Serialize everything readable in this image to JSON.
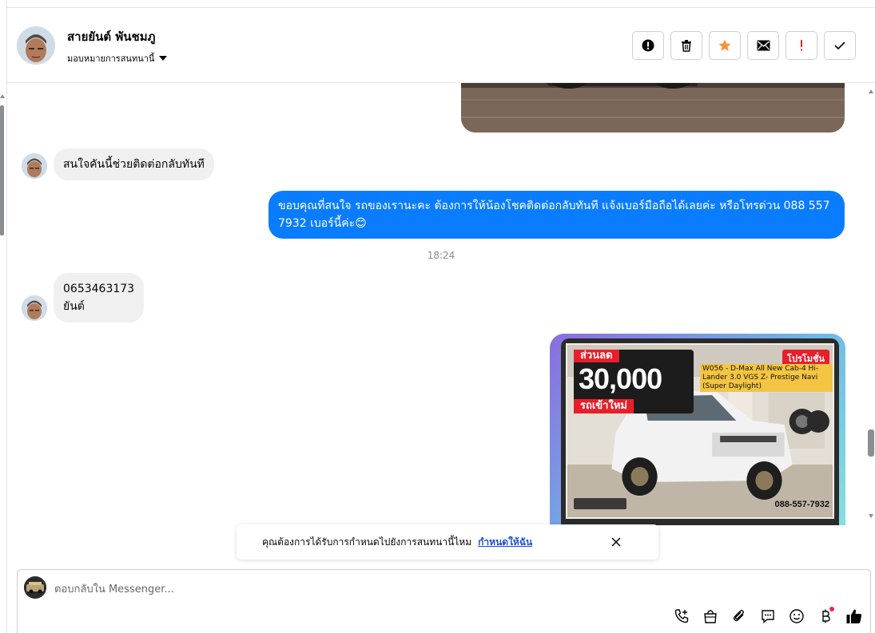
{
  "header": {
    "contact_name": "สายยันต์ พันชมภู",
    "assign_label": "มอบหมายการสนทนานี้",
    "actions": [
      "spam-report",
      "delete",
      "star",
      "mark-unread",
      "important",
      "mark-done"
    ]
  },
  "messages": [
    {
      "from": "contact",
      "text": "สนใจคันนี้ช่วยติดต่อกลับทันที"
    },
    {
      "from": "page",
      "text": "ขอบคุณที่สนใจ รถของเรานะคะ ต้องการให้น้องโชคติดต่อกลับทันที แจ้งเบอร์มือถือได้เลยค่ะ หรือโทรด่วน 088 557 7932 เบอร์นี้ค่ะ😊"
    },
    {
      "from": "contact",
      "text": "0653463173\nยันต์"
    }
  ],
  "timestamp": "18:24",
  "promo_image": {
    "discount_tag": "ส่วนลด",
    "discount_value": "30,000",
    "new_arrival": "รถเข้าใหม่",
    "promo_badge": "โปรโมชั่น",
    "model_text": "W056 - D-Max All New Cab-4 Hi-Lander 3.0 VGS Z- Prestige Navi (Super Daylight)",
    "phone": "088-557-7932"
  },
  "notice": {
    "text": "คุณต้องการได้รับการกำหนดไปยังการสนทนานี้ไหม",
    "link": "กำหนดให้ฉัน"
  },
  "composer": {
    "placeholder": "ตอบกลับใน Messenger...",
    "tools": [
      "call-add-icon",
      "shopping-bag-icon",
      "paperclip-icon",
      "saved-reply-icon",
      "emoji-icon",
      "baht-icon",
      "thumbs-up-icon"
    ]
  },
  "colors": {
    "outgoing_bubble": "#0a7cff",
    "incoming_bubble": "#f0f0f0",
    "star": "#f7923b",
    "alert": "#e02d2d",
    "link": "#1a4fd6"
  }
}
